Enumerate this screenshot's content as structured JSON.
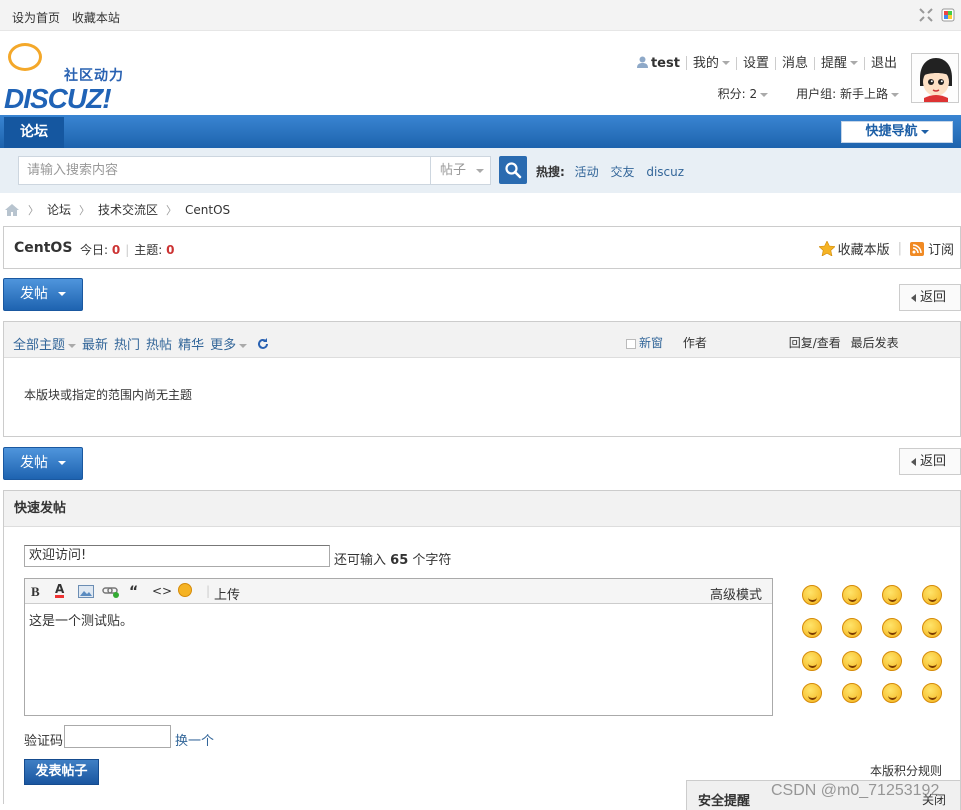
{
  "topbar": {
    "set_home": "设为首页",
    "bookmark": "收藏本站"
  },
  "logo": {
    "tagline": "社区动力",
    "wordmark": "DISCUZ!"
  },
  "user": {
    "name": "test",
    "menu": [
      "我的",
      "设置",
      "消息",
      "提醒",
      "退出"
    ],
    "points_label": "积分: 2",
    "group_label": "用户组: 新手上路"
  },
  "nav": {
    "forum_tab": "论坛",
    "quick_nav": "快捷导航"
  },
  "search": {
    "placeholder": "请输入搜索内容",
    "scope": "帖子",
    "hot_label": "热搜:",
    "hot_terms": [
      "活动",
      "交友",
      "discuz"
    ]
  },
  "breadcrumb": [
    "论坛",
    "技术交流区",
    "CentOS"
  ],
  "forum": {
    "name": "CentOS",
    "today_label": "今日:",
    "today_count": "0",
    "topics_label": "主题:",
    "topics_count": "0",
    "favorite": "收藏本版",
    "subscribe": "订阅"
  },
  "actions": {
    "post": "发帖",
    "back": "返回"
  },
  "thread_list": {
    "filters": [
      "全部主题",
      "最新",
      "热门",
      "热帖",
      "精华",
      "更多"
    ],
    "new_window": "新窗",
    "author_col": "作者",
    "reply_col": "回复/查看",
    "last_post_col": "最后发表",
    "empty_message": "本版块或指定的范围内尚无主题"
  },
  "quick_post": {
    "heading": "快速发帖",
    "title_value": "欢迎访问!",
    "remaining_prefix": "还可输入",
    "remaining_count": "65",
    "remaining_suffix": "个字符",
    "upload": "上传",
    "advanced": "高级模式",
    "body_value": "这是一个测试贴。",
    "captcha_label": "验证码",
    "captcha_refresh": "换一个",
    "submit": "发表帖子",
    "rules": "本版积分规则"
  },
  "security_popup": {
    "title": "安全提醒",
    "close": "关闭"
  },
  "watermark": "CSDN @m0_71253192",
  "colors": {
    "nav_blue": "#1d63ad",
    "link": "#336699",
    "count_red": "#cc3333"
  }
}
